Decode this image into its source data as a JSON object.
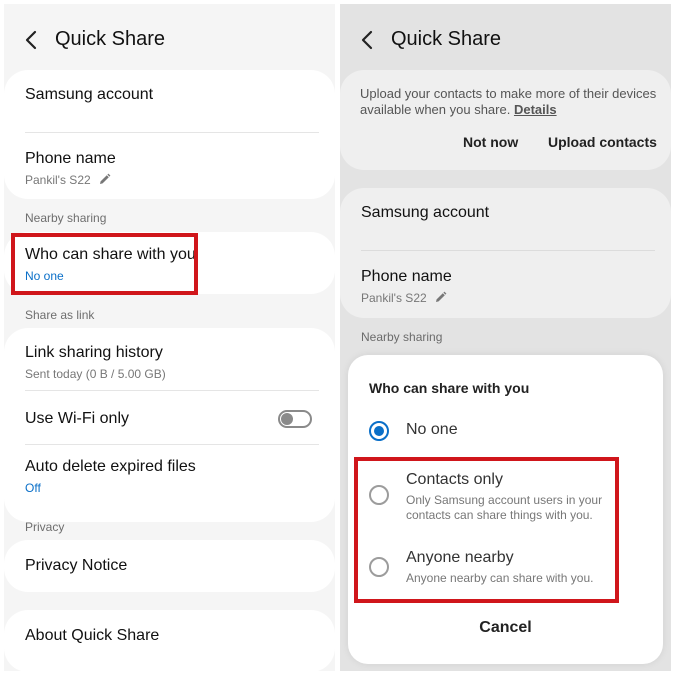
{
  "left": {
    "title": "Quick Share",
    "samsung_account": "Samsung account",
    "phone_name_label": "Phone name",
    "phone_name_value": "Pankil's S22",
    "nearby_sharing_label": "Nearby sharing",
    "who_can_share_label": "Who can share with you",
    "who_can_share_value": "No one",
    "share_as_link_label": "Share as link",
    "link_history_label": "Link sharing history",
    "link_history_value": "Sent today (0 B / 5.00 GB)",
    "wifi_only_label": "Use Wi-Fi only",
    "wifi_only_on": false,
    "auto_delete_label": "Auto delete expired files",
    "auto_delete_value": "Off",
    "privacy_label": "Privacy",
    "privacy_notice_label": "Privacy Notice",
    "about_label": "About Quick Share"
  },
  "right": {
    "title": "Quick Share",
    "upload_message": "Upload your contacts to make more of their devices available when you share.",
    "details_link": "Details",
    "not_now": "Not now",
    "upload_contacts": "Upload contacts",
    "samsung_account": "Samsung account",
    "phone_name_label": "Phone name",
    "phone_name_value": "Pankil's S22",
    "nearby_sharing_label": "Nearby sharing",
    "dialog": {
      "title": "Who can share with you",
      "options": [
        {
          "label": "No one",
          "desc": "",
          "selected": true
        },
        {
          "label": "Contacts only",
          "desc": "Only Samsung account users in your contacts can share things with you.",
          "selected": false
        },
        {
          "label": "Anyone nearby",
          "desc": "Anyone nearby can share with you.",
          "selected": false
        }
      ],
      "cancel": "Cancel"
    }
  },
  "colors": {
    "highlight": "#d0161b",
    "accent_blue": "#0a6fc8"
  }
}
